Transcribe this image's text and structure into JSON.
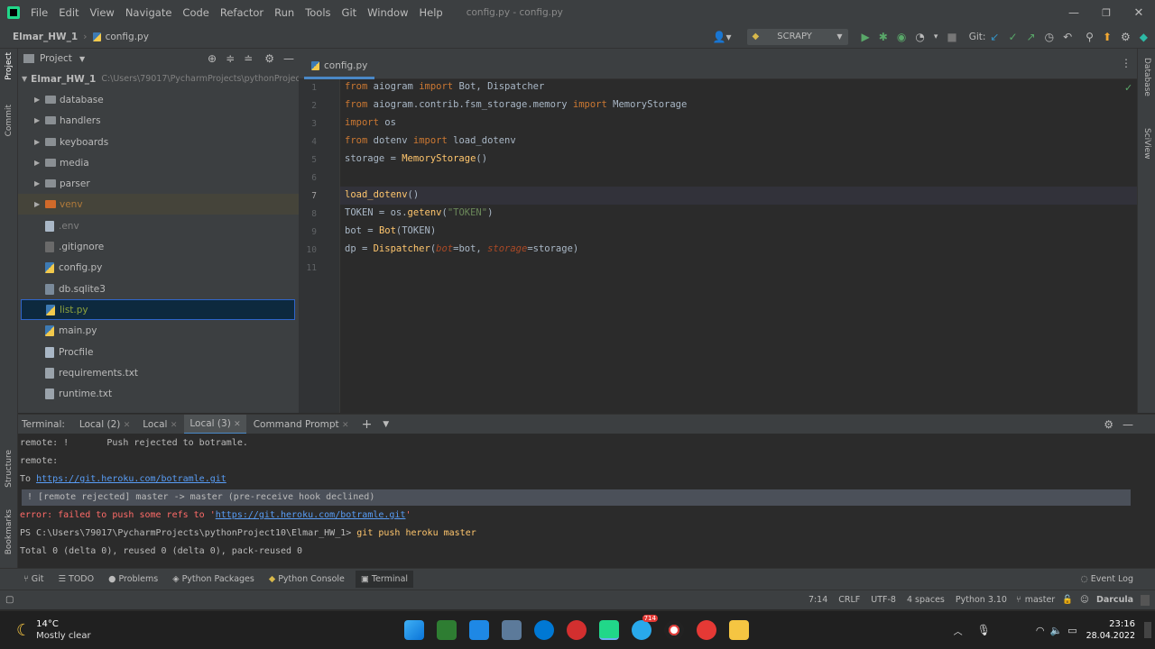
{
  "titlebar": {
    "menu": [
      "File",
      "Edit",
      "View",
      "Navigate",
      "Code",
      "Refactor",
      "Run",
      "Tools",
      "Git",
      "Window",
      "Help"
    ],
    "title": "config.py - config.py"
  },
  "navbar": {
    "project": "Elmar_HW_1",
    "file": "config.py",
    "run_config": "SCRAPY",
    "git_label": "Git:"
  },
  "project_panel": {
    "title": "Project",
    "root_name": "Elmar_HW_1",
    "root_path": "C:\\Users\\79017\\PycharmProjects\\pythonProject10\\Elmar_HW_1",
    "items": [
      {
        "name": "database",
        "type": "folder"
      },
      {
        "name": "handlers",
        "type": "folder"
      },
      {
        "name": "keyboards",
        "type": "folder"
      },
      {
        "name": "media",
        "type": "folder"
      },
      {
        "name": "parser",
        "type": "folder"
      },
      {
        "name": "venv",
        "type": "venv"
      },
      {
        "name": ".env",
        "type": "file"
      },
      {
        "name": ".gitignore",
        "type": "file"
      },
      {
        "name": "config.py",
        "type": "py"
      },
      {
        "name": "db.sqlite3",
        "type": "file"
      },
      {
        "name": "list.py",
        "type": "py"
      },
      {
        "name": "main.py",
        "type": "py"
      },
      {
        "name": "Procfile",
        "type": "file"
      },
      {
        "name": "requirements.txt",
        "type": "txt"
      },
      {
        "name": "runtime.txt",
        "type": "txt"
      }
    ]
  },
  "left_strip": {
    "project": "Project",
    "commit": "Commit",
    "structure": "Structure",
    "bookmarks": "Bookmarks"
  },
  "right_strip": {
    "database": "Database",
    "sciview": "SciView"
  },
  "editor": {
    "tab": "config.py",
    "line_numbers": [
      "1",
      "2",
      "3",
      "4",
      "5",
      "6",
      "7",
      "8",
      "9",
      "10",
      "11"
    ],
    "lines": [
      "from aiogram import Bot, Dispatcher",
      "from aiogram.contrib.fsm_storage.memory import MemoryStorage",
      "import os",
      "from dotenv import load_dotenv",
      "storage = MemoryStorage()",
      "",
      "load_dotenv()",
      "TOKEN = os.getenv(\"TOKEN\")",
      "bot = Bot(TOKEN)",
      "dp = Dispatcher(bot=bot, storage=storage)",
      ""
    ]
  },
  "terminal": {
    "label": "Terminal:",
    "tabs": [
      "Local (2)",
      "Local",
      "Local (3)",
      "Command Prompt"
    ],
    "lines": {
      "l1": "remote: !       Push rejected to botramle.",
      "l2": "remote:",
      "l3_prefix": "To ",
      "l3_link": "https://git.heroku.com/botramle.git",
      "l4": " ! [remote rejected] master -> master (pre-receive hook declined)",
      "l5_prefix": "error: failed to push some refs to '",
      "l5_link": "https://git.heroku.com/botramle.git",
      "l5_suffix": "'",
      "l6_prompt": "PS C:\\Users\\79017\\PycharmProjects\\pythonProject10\\Elmar_HW_1> ",
      "l6_cmd": "git push heroku master",
      "l7": "Total 0 (delta 0), reused 0 (delta 0), pack-reused 0"
    }
  },
  "toolwindows": [
    "Git",
    "TODO",
    "Problems",
    "Python Packages",
    "Python Console",
    "Terminal"
  ],
  "event_log": "Event Log",
  "status": {
    "position": "7:14",
    "line_sep": "CRLF",
    "encoding": "UTF-8",
    "indent": "4 spaces",
    "interpreter": "Python 3.10",
    "branch": "master",
    "theme": "Darcula"
  },
  "taskbar": {
    "temp": "14°C",
    "weather": "Mostly clear",
    "time": "23:16",
    "date": "28.04.2022",
    "badge": "714"
  }
}
